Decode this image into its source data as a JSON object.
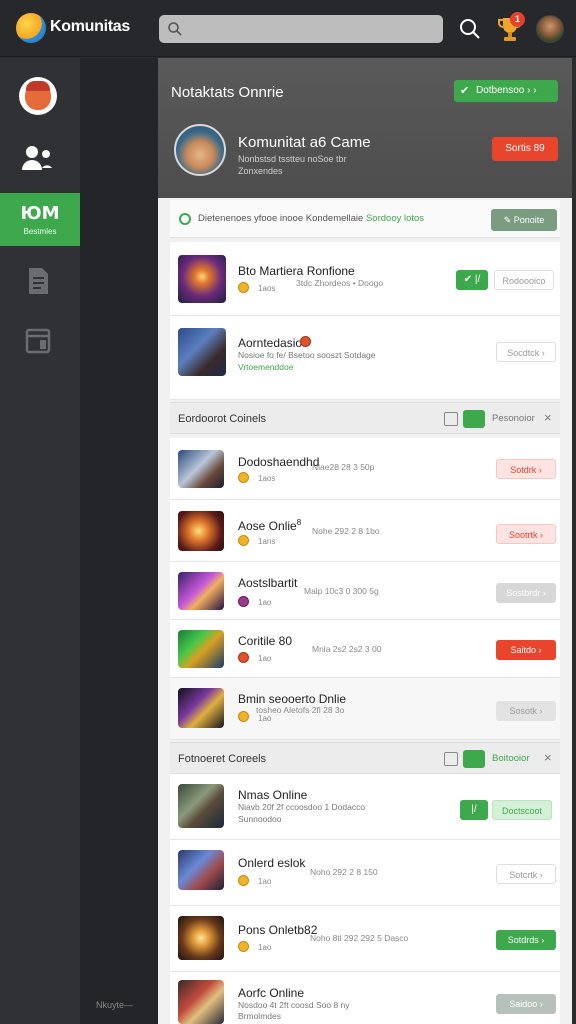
{
  "app": {
    "name": "Komunitas"
  },
  "topbar": {
    "notifications": "1"
  },
  "sidebar": {
    "active_glyph": "ЮМ",
    "active_label": "Bestmles",
    "footer": "Nkuyte—"
  },
  "panel": {
    "title": "Notaktats Onnrie",
    "header_button": "Dotbensoo",
    "header_button_suffix": "› ›",
    "profile": {
      "name": "Komunitat a6 Came",
      "sub_line1": "Nonbstsd tsstteu noSoe tbr",
      "sub_line2": "Zonxendes",
      "action": "Sortis 89"
    },
    "info": {
      "text": "Dietenenoes yfooe inooe Kondemellaie",
      "highlight": "Sordooy lotos",
      "button": "Ponoite"
    }
  },
  "featured": [
    {
      "title": "Bto Martiera Ronfione",
      "meta": "1aos",
      "extra": "3tdc Zhordeos • Doogo",
      "check": "✔",
      "check2": "|/",
      "action": "Rodoooico"
    },
    {
      "title": "Aorntedasio",
      "sub": "Nosioe fo fe/ Bsetoo sooszt Sotdage",
      "link": "Vrtoemenddoe",
      "action": "Socdtck ›"
    }
  ],
  "sections": [
    {
      "title": "Eordoorot Coinels",
      "label": "Pesonoior",
      "close": "×"
    },
    {
      "title": "Fotnoeret Coreels",
      "label": "Boitooior",
      "close": "×"
    }
  ],
  "games": [
    {
      "title": "Dodoshaendhd",
      "meta": "1aos",
      "num": "Niae28 28 3 50p",
      "action": "Sotdrk ›"
    },
    {
      "title": "Aose Onlie",
      "title_suffix": "8",
      "meta": "1ans",
      "num": "Nohe 292 2 8 1bo",
      "action": "Sootrtk ›"
    },
    {
      "title": "Aostslbartit",
      "meta": "1ao",
      "num": "Malp 10c3 0 300 5g",
      "action": "Sostbrdr ›"
    },
    {
      "title": "Coritile 80",
      "meta": "1ao",
      "num": "Mnla 2s2 2s2 3 00",
      "action": "Saitdo ›"
    },
    {
      "title": "Bmin seooerto Dnlie",
      "meta": "1ao",
      "num": "tosheo Aletofs 2fl 28 3o",
      "action": "Sosotk ›"
    }
  ],
  "games2": [
    {
      "title": "Nmas Online",
      "sub": "Niavb 20f 2f ccoosdoo 1 Dodacco",
      "sub2": "Sunnoodoo",
      "check": "|/",
      "action": "Doctscoot"
    },
    {
      "title": "Onlerd eslok",
      "meta": "1ao",
      "num": "Noho 292 2 8 150",
      "action": "Sotcrtk ›"
    },
    {
      "title": "Pons Onletb82",
      "meta": "1ao",
      "num": "Noho 8tl 292 292 5 Dasco",
      "action": "Sotdrds ›"
    },
    {
      "title": "Aorfc Online",
      "sub": "Nosdoo 4t 2ft coosd Soo 8 ny",
      "sub2": "Brmolmdes",
      "action": "Saidoo ›"
    }
  ]
}
